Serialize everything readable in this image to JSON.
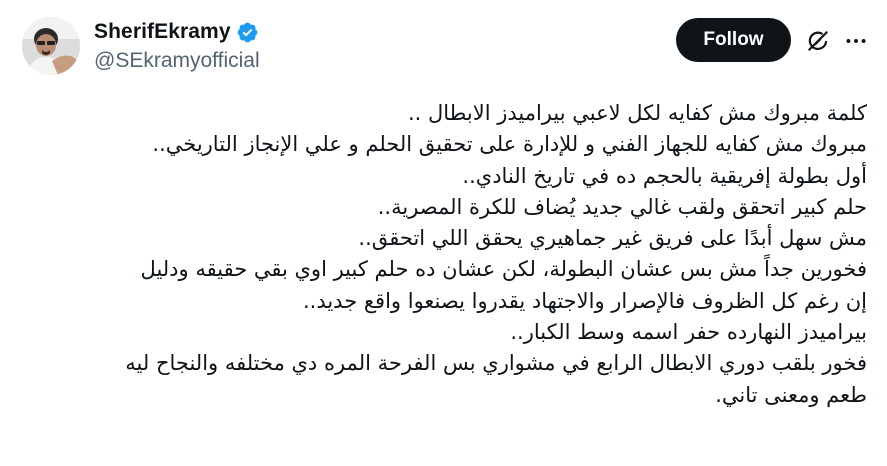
{
  "author": {
    "display_name": "SherifEkramy",
    "handle": "@SEkramyofficial",
    "verified": true
  },
  "actions": {
    "follow_label": "Follow"
  },
  "icons": {
    "verified": "verified-badge-icon",
    "grok": "grok-icon",
    "more": "more-icon"
  },
  "colors": {
    "verified_blue": "#1d9bf0",
    "follow_bg": "#0f1419",
    "text": "#0f1419",
    "muted": "#536471"
  },
  "tweet": {
    "lines": [
      "كلمة مبروك مش كفايه لكل لاعبي بيراميدز الابطال ..",
      "مبروك مش كفايه للجهاز الفني و للإدارة على تحقيق الحلم و علي الإنجاز التاريخي..",
      "أول بطولة إفريقية بالحجم ده في تاريخ النادي..",
      "حلم كبير اتحقق ولقب غالي جديد يُضاف للكرة المصرية..",
      "مش سهل أبدًا على فريق غير جماهيري يحقق اللي اتحقق..",
      "فخورين جداً مش بس عشان البطولة، لكن عشان ده حلم كبير اوي بقي حقيقه ودليل",
      "إن رغم كل الظروف فالإصرار والاجتهاد يقدروا يصنعوا واقع جديد..",
      "بيراميدز النهارده حفر اسمه وسط الكبار..",
      "فخور بلقب دوري الابطال الرابع في مشواري بس الفرحة المره دي مختلفه والنجاح ليه",
      "طعم ومعنى تاني."
    ]
  }
}
